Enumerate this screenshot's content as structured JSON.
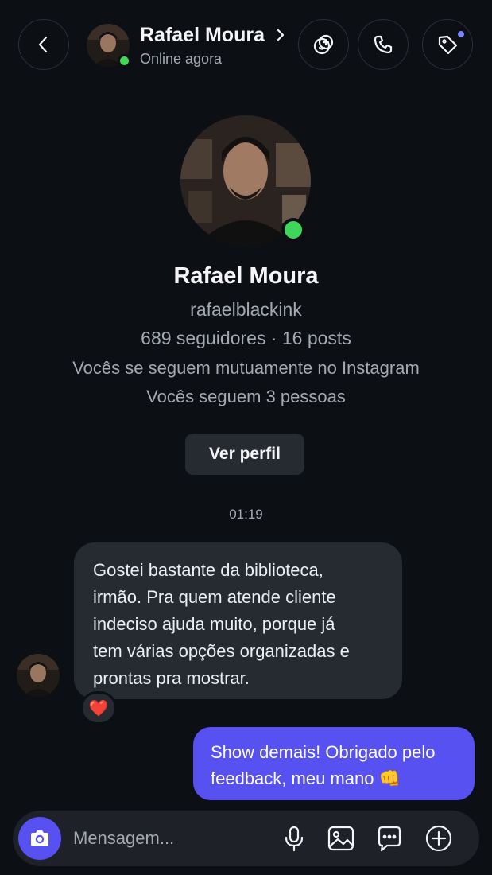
{
  "header": {
    "name": "Rafael Moura",
    "status": "Online agora",
    "icons": [
      "back-chevron-icon",
      "effects-icon",
      "phone-icon",
      "tag-icon"
    ],
    "notification_dot_color": "#7a86ff",
    "online_color": "#3fd65a"
  },
  "profile": {
    "name": "Rafael Moura",
    "username": "rafaelblackink",
    "stats": "689 seguidores · 16 posts",
    "mutual": "Vocês se seguem mutuamente no Instagram",
    "following": "Vocês seguem 3 pessoas",
    "view_profile_label": "Ver perfil"
  },
  "conversation": {
    "timestamp": "01:19",
    "messages": [
      {
        "direction": "incoming",
        "lines": [
          "Gostei bastante da biblioteca,",
          "irmão. Pra quem atende cliente",
          "indeciso ajuda muito, porque já",
          "tem várias opções organizadas e",
          "prontas pra mostrar."
        ],
        "reaction": "❤️"
      },
      {
        "direction": "outgoing",
        "lines": [
          "Show demais! Obrigado pelo",
          "feedback, meu mano 👊"
        ],
        "bubble_color": "#5651f0"
      }
    ]
  },
  "composer": {
    "placeholder": "Mensagem...",
    "accent": "#5651f0",
    "icons": [
      "camera-icon",
      "microphone-icon",
      "gallery-icon",
      "sticker-icon",
      "plus-icon"
    ]
  }
}
